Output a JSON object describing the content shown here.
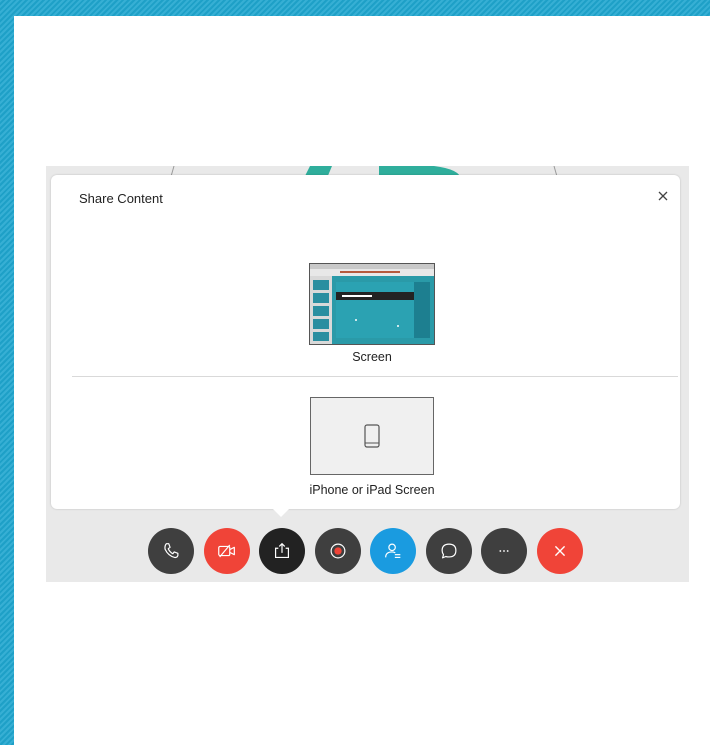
{
  "dialog": {
    "title": "Share Content",
    "close_label": "close"
  },
  "share_options": [
    {
      "label": "Screen"
    },
    {
      "label": "iPhone or iPad Screen"
    }
  ],
  "controls": [
    {
      "name": "phone",
      "icon": "phone-icon",
      "color": "#3f3f3f"
    },
    {
      "name": "video-off",
      "icon": "video-off-icon",
      "color": "#f04438"
    },
    {
      "name": "share",
      "icon": "share-icon",
      "color": "#222222"
    },
    {
      "name": "record",
      "icon": "record-icon",
      "color": "#3f3f3f"
    },
    {
      "name": "participants",
      "icon": "participants-icon",
      "color": "#1a9be0"
    },
    {
      "name": "chat",
      "icon": "chat-icon",
      "color": "#3f3f3f"
    },
    {
      "name": "more",
      "icon": "more-icon",
      "color": "#3f3f3f"
    },
    {
      "name": "leave",
      "icon": "close-icon",
      "color": "#f04438"
    }
  ],
  "colors": {
    "background": "#1fa6cf",
    "accent_teal": "#2fae9c",
    "danger": "#f04438",
    "primary": "#1a9be0"
  }
}
